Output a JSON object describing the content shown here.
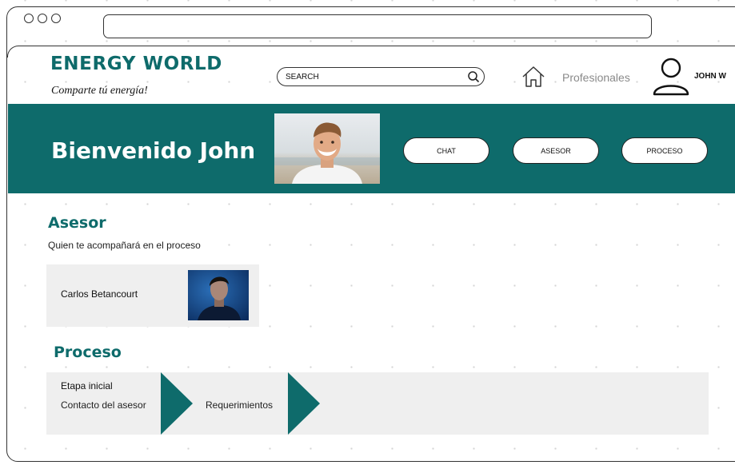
{
  "browser": {
    "address": ""
  },
  "header": {
    "brand": "ENERGY WORLD",
    "tagline": "Comparte tú energía!",
    "search_placeholder": "SEARCH",
    "nav_link": "Profesionales",
    "user_name": "JOHN W"
  },
  "banner": {
    "welcome": "Bienvenido John",
    "buttons": [
      "CHAT",
      "ASESOR",
      "PROCESO"
    ]
  },
  "asesor": {
    "title": "Asesor",
    "subtitle": "Quien te acompañará en el proceso",
    "advisor_name": "Carlos Betancourt"
  },
  "proceso": {
    "title": "Proceso",
    "stage_title": "Etapa inicial",
    "steps": [
      "Contacto del asesor",
      "Requerimientos"
    ]
  },
  "colors": {
    "brand": "#0e6b6b",
    "card_bg": "#efefef"
  },
  "icons": [
    "search-icon",
    "home-icon",
    "user-icon"
  ]
}
